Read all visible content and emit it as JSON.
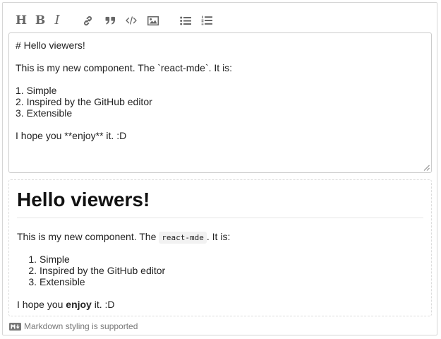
{
  "toolbar": {
    "header_glyph": "H",
    "bold_glyph": "B",
    "italic_glyph": "I",
    "items": [
      "header-icon",
      "bold-icon",
      "italic-icon",
      "link-icon",
      "quote-icon",
      "code-icon",
      "image-icon",
      "unordered-list-icon",
      "ordered-list-icon"
    ]
  },
  "editor": {
    "value": "# Hello viewers!\n\nThis is my new component. The `react-mde`. It is:\n\n1. Simple\n2. Inspired by the GitHub editor\n3. Extensible\n\nI hope you **enjoy** it. :D"
  },
  "preview": {
    "heading": "Hello viewers!",
    "intro_before": "This is my new component. The ",
    "intro_code": "react-mde",
    "intro_after": ". It is:",
    "list": [
      {
        "num": "1.",
        "text": "Simple"
      },
      {
        "num": "2.",
        "text": "Inspired by the GitHub editor"
      },
      {
        "num": "3.",
        "text": "Extensible"
      }
    ],
    "closing_before": "I hope you ",
    "closing_bold": "enjoy",
    "closing_after": " it. :D"
  },
  "footer": {
    "text": "Markdown styling is supported"
  },
  "colors": {
    "icon": "#666666",
    "border": "#cccccc",
    "footer_text": "#777777"
  }
}
